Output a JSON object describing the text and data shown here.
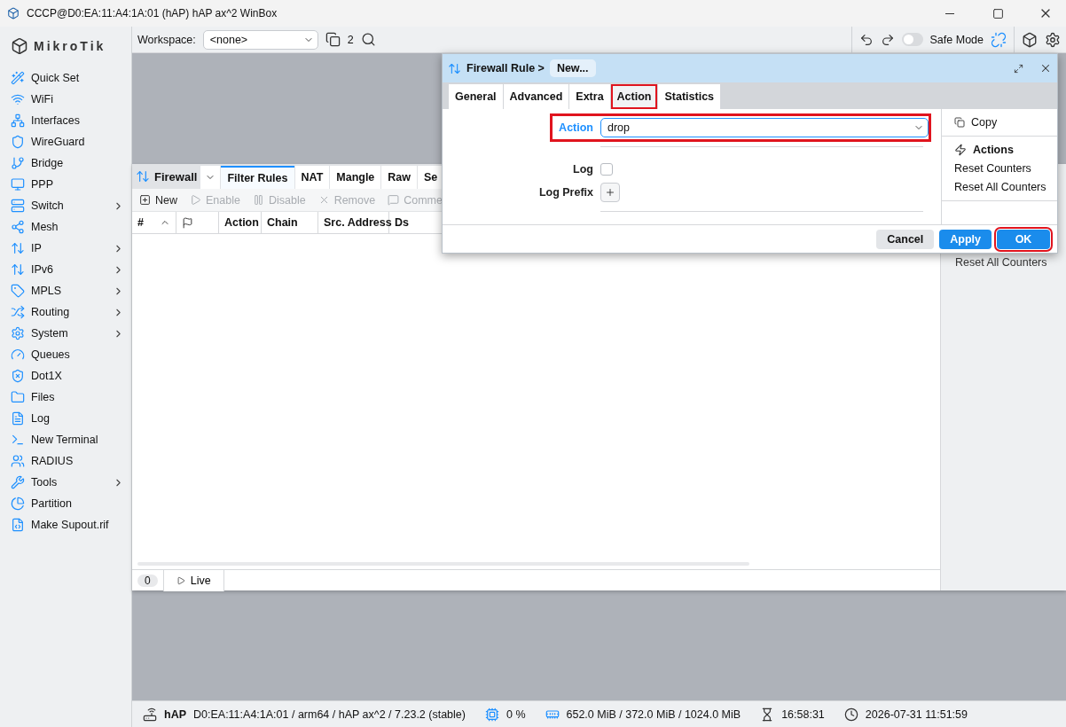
{
  "window": {
    "title": "CCCP@D0:EA:11:A4:1A:01 (hAP) hAP ax^2 WinBox"
  },
  "sidebar": {
    "brand": "MikroTik",
    "items": [
      {
        "label": "Quick Set",
        "submenu": false
      },
      {
        "label": "WiFi",
        "submenu": false
      },
      {
        "label": "Interfaces",
        "submenu": false
      },
      {
        "label": "WireGuard",
        "submenu": false
      },
      {
        "label": "Bridge",
        "submenu": false
      },
      {
        "label": "PPP",
        "submenu": false
      },
      {
        "label": "Switch",
        "submenu": true
      },
      {
        "label": "Mesh",
        "submenu": false
      },
      {
        "label": "IP",
        "submenu": true
      },
      {
        "label": "IPv6",
        "submenu": true
      },
      {
        "label": "MPLS",
        "submenu": true
      },
      {
        "label": "Routing",
        "submenu": true
      },
      {
        "label": "System",
        "submenu": true
      },
      {
        "label": "Queues",
        "submenu": false
      },
      {
        "label": "Dot1X",
        "submenu": false
      },
      {
        "label": "Files",
        "submenu": false
      },
      {
        "label": "Log",
        "submenu": false
      },
      {
        "label": "New Terminal",
        "submenu": false
      },
      {
        "label": "RADIUS",
        "submenu": false
      },
      {
        "label": "Tools",
        "submenu": true
      },
      {
        "label": "Partition",
        "submenu": false
      },
      {
        "label": "Make Supout.rif",
        "submenu": false
      }
    ]
  },
  "toolbar": {
    "workspace_label": "Workspace:",
    "workspace_value": "<none>",
    "windows_count": "2",
    "safe_mode": {
      "label": "Safe Mode",
      "on": false
    }
  },
  "firewall": {
    "title": "Firewall",
    "tabs": [
      {
        "label": "Filter Rules",
        "selected": true
      },
      {
        "label": "NAT",
        "selected": false
      },
      {
        "label": "Mangle",
        "selected": false
      },
      {
        "label": "Raw",
        "selected": false
      },
      {
        "label": "Se",
        "selected": false
      }
    ],
    "actions": [
      {
        "label": "New",
        "disabled": false
      },
      {
        "label": "Enable",
        "disabled": true
      },
      {
        "label": "Disable",
        "disabled": true
      },
      {
        "label": "Remove",
        "disabled": true
      },
      {
        "label": "Comme",
        "disabled": true
      }
    ],
    "columns": [
      "#",
      "Action",
      "Chain",
      "Src. Address",
      "Ds"
    ],
    "side_panel": [
      "Reset All Counters"
    ],
    "count": "0",
    "live": "Live"
  },
  "dialog": {
    "title": "Firewall Rule >",
    "crumb": "New...",
    "tabs": [
      {
        "label": "General",
        "selected": false,
        "highlighted": false
      },
      {
        "label": "Advanced",
        "selected": false,
        "highlighted": false
      },
      {
        "label": "Extra",
        "selected": false,
        "highlighted": false
      },
      {
        "label": "Action",
        "selected": true,
        "highlighted": true
      },
      {
        "label": "Statistics",
        "selected": false,
        "highlighted": false
      }
    ],
    "action_field": {
      "label": "Action",
      "value": "drop",
      "highlighted": true
    },
    "log": {
      "label": "Log",
      "checked": false
    },
    "log_prefix": {
      "label": "Log Prefix"
    },
    "side": {
      "copy": "Copy",
      "actions_heading": "Actions",
      "items": [
        "Reset Counters",
        "Reset All Counters"
      ]
    },
    "buttons": [
      {
        "label": "Cancel",
        "kind": "secondary",
        "highlighted": false
      },
      {
        "label": "Apply",
        "kind": "primary",
        "highlighted": false
      },
      {
        "label": "OK",
        "kind": "primary",
        "highlighted": true
      }
    ]
  },
  "status_bar": {
    "device": "hAP",
    "info": "D0:EA:11:A4:1A:01 / arm64 / hAP ax^2 / 7.23.2 (stable)",
    "cpu": "0 %",
    "memory": "652.0 MiB / 372.0 MiB / 1024.0 MiB",
    "uptime": "16:58:31",
    "clock": "2026-07-31 11:51:59"
  }
}
